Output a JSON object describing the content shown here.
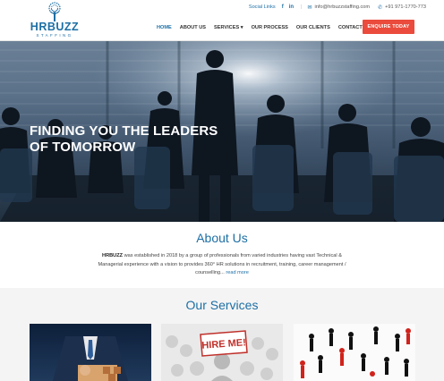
{
  "brand": {
    "name": "HRBUZZ",
    "tagline": "STAFFING"
  },
  "topbar": {
    "social_label": "Social Links",
    "facebook_glyph": "f",
    "linkedin_glyph": "in",
    "separator": "|",
    "email": "info@hrbuzzstaffing.com",
    "phone": "+91 971-1770-773"
  },
  "nav": {
    "items": [
      {
        "label": "HOME"
      },
      {
        "label": "ABOUT US"
      },
      {
        "label": "SERVICES ▾"
      },
      {
        "label": "OUR PROCESS"
      },
      {
        "label": "OUR CLIENTS"
      },
      {
        "label": "CONTACT US"
      }
    ],
    "cta": "ENQUIRE TODAY"
  },
  "hero": {
    "line1": "FINDING YOU THE LEADERS",
    "line2": "OF TOMORROW"
  },
  "about": {
    "heading": "About Us",
    "brand": "HRBUZZ",
    "text": " was established in 2018 by a group of professionals from varied industries having vast Technical & Managerial experience with a vision to provides 360° HR solutions in recruitment, training, career management / counselling...",
    "more": "read more"
  },
  "services": {
    "heading": "Our Services",
    "sign_text": "HIRE ME!"
  },
  "colors": {
    "brand_blue": "#1d6fa5",
    "cta_red": "#ea4b3c"
  },
  "icons": [
    "tree-logo-icon",
    "facebook-icon",
    "linkedin-icon",
    "email-icon",
    "phone-icon"
  ]
}
